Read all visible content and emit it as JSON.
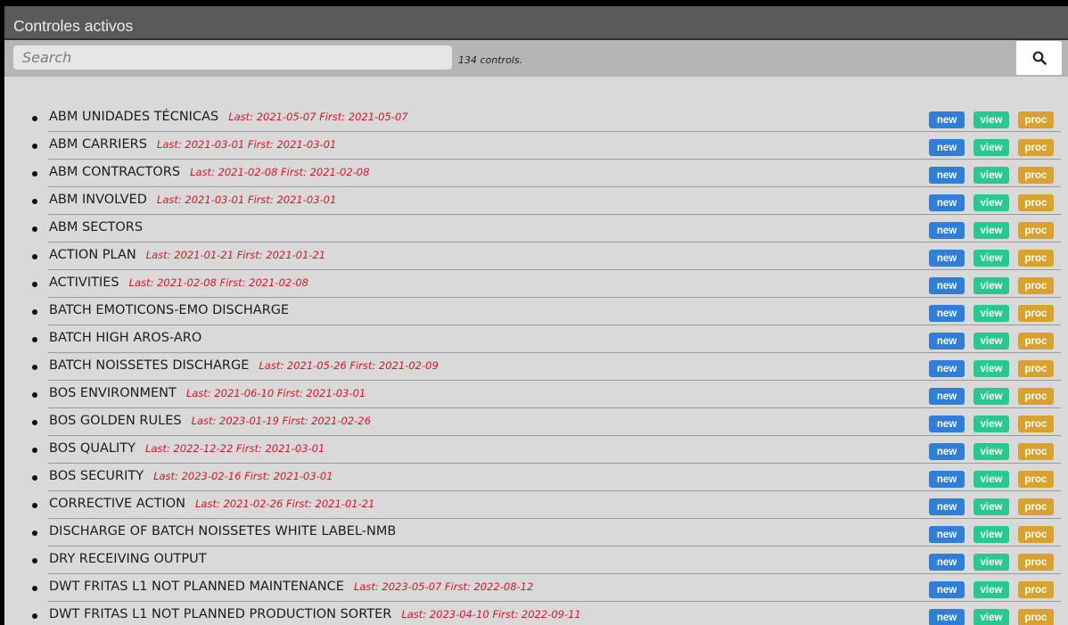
{
  "window": {
    "title": "Controles activos"
  },
  "search": {
    "placeholder": "Search",
    "count_text": "134 controls."
  },
  "buttons": {
    "new": "new",
    "view": "view",
    "proc": "proc"
  },
  "colors": {
    "new": "#2f7ed8",
    "view": "#27c98f",
    "proc": "#d8a22c",
    "dates": "#d41a2a"
  },
  "items": [
    {
      "name": "ABM UNIDADES TÉCNICAS",
      "dates": "Last: 2021-05-07 First: 2021-05-07"
    },
    {
      "name": "ABM CARRIERS",
      "dates": "Last: 2021-03-01 First: 2021-03-01"
    },
    {
      "name": "ABM CONTRACTORS",
      "dates": "Last: 2021-02-08 First: 2021-02-08"
    },
    {
      "name": "ABM INVOLVED",
      "dates": "Last: 2021-03-01 First: 2021-03-01"
    },
    {
      "name": "ABM SECTORS",
      "dates": ""
    },
    {
      "name": "ACTION PLAN",
      "dates": "Last: 2021-01-21 First: 2021-01-21"
    },
    {
      "name": "ACTIVITIES",
      "dates": "Last: 2021-02-08 First: 2021-02-08"
    },
    {
      "name": "BATCH EMOTICONS-EMO DISCHARGE",
      "dates": ""
    },
    {
      "name": "BATCH HIGH AROS-ARO",
      "dates": ""
    },
    {
      "name": "BATCH NOISSETES DISCHARGE",
      "dates": "Last: 2021-05-26 First: 2021-02-09"
    },
    {
      "name": "BOS ENVIRONMENT",
      "dates": "Last: 2021-06-10 First: 2021-03-01"
    },
    {
      "name": "BOS GOLDEN RULES",
      "dates": "Last: 2023-01-19 First: 2021-02-26"
    },
    {
      "name": "BOS QUALITY",
      "dates": "Last: 2022-12-22 First: 2021-03-01"
    },
    {
      "name": "BOS SECURITY",
      "dates": "Last: 2023-02-16 First: 2021-03-01"
    },
    {
      "name": "CORRECTIVE ACTION",
      "dates": "Last: 2021-02-26 First: 2021-01-21"
    },
    {
      "name": "DISCHARGE OF BATCH NOISSETES WHITE LABEL-NMB",
      "dates": ""
    },
    {
      "name": "DRY RECEIVING OUTPUT",
      "dates": ""
    },
    {
      "name": "DWT FRITAS L1 NOT PLANNED MAINTENANCE",
      "dates": "Last: 2023-05-07 First: 2022-08-12"
    },
    {
      "name": "DWT FRITAS L1 NOT PLANNED PRODUCTION SORTER",
      "dates": "Last: 2023-04-10 First: 2022-09-11"
    }
  ]
}
